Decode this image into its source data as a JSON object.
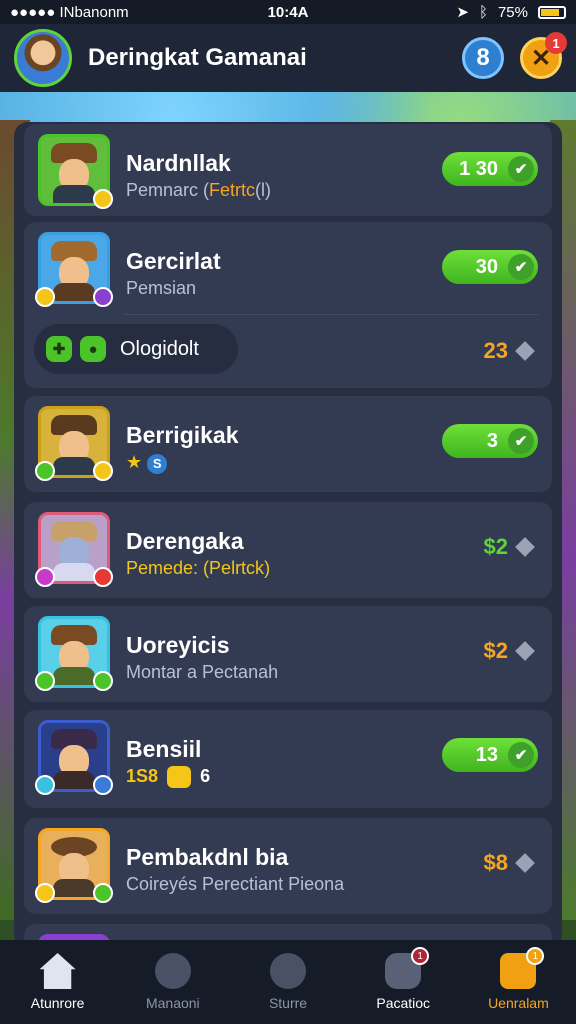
{
  "status_bar": {
    "carrier": "●●●●● INbanonm",
    "time": "10:4A",
    "battery": "75%"
  },
  "header": {
    "title": "Deringkat Gamanai",
    "coin_value": "8",
    "close_badge": "1"
  },
  "rows": [
    {
      "name": "Nardnllak",
      "sub_text": "Pemnarc (",
      "sub_highlight": "Fetrtc",
      "sub_tail": "(l)",
      "value": "1 30",
      "value_type": "pill",
      "frame_color": "#4bc42a"
    },
    {
      "name": "Gercirlat",
      "sub_text": "Pemsian",
      "value": "30",
      "value_type": "pill",
      "frame_color": "#3aa0e0",
      "inner_label": "Ologidolt",
      "inner_value": "23"
    },
    {
      "name": "Berrigikak",
      "sub_icon_text": "S",
      "value": "3",
      "value_type": "pill",
      "frame_color": "#f5c518"
    },
    {
      "name": "Derengaka",
      "sub_text": "Pemede: (",
      "sub_highlight": "Pelrtck",
      "sub_tail": ")",
      "value": "$2",
      "value_type": "green",
      "frame_color": "#e05a7a"
    },
    {
      "name": "Uoreyicis",
      "sub_text": "Montar a Pectanah",
      "value": "$2",
      "value_type": "gold",
      "frame_color": "#3ac0e0"
    },
    {
      "name": "Bensiil",
      "sub_num_a": "1S8",
      "sub_num_b": "6",
      "value": "13",
      "value_type": "pill",
      "frame_color": "#3a5cd0"
    },
    {
      "name": "Pembakdnl bia",
      "sub_text": "Coireyés Perectiant Pieona",
      "value": "$8",
      "value_type": "gold",
      "frame_color": "#f5a623"
    }
  ],
  "nav": [
    {
      "label": "Atunrore",
      "icon": "home-icon"
    },
    {
      "label": "Manaoni",
      "icon": "user-icon"
    },
    {
      "label": "Sturre",
      "icon": "store-icon"
    },
    {
      "label": "Pacatioc",
      "icon": "map-icon",
      "badge": "1"
    },
    {
      "label": "Uenralam",
      "icon": "trophy-icon",
      "badge": "1"
    }
  ]
}
